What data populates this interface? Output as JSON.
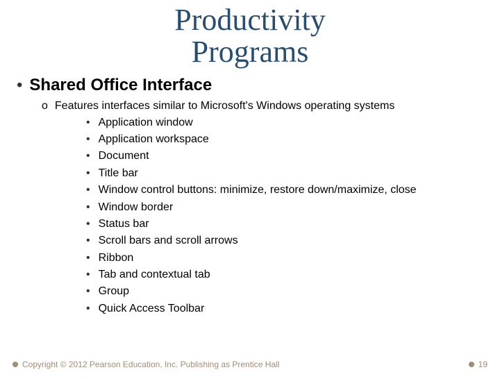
{
  "title_line1": "Productivity",
  "title_line2": "Programs",
  "heading": "Shared Office Interface",
  "subheading": "Features interfaces similar to Microsoft's Windows operating systems",
  "items": [
    "Application window",
    "Application workspace",
    "Document",
    "Title bar",
    "Window control buttons: minimize, restore down/maximize, close",
    "Window border",
    "Status bar",
    "Scroll bars and scroll arrows",
    "Ribbon",
    "Tab and contextual tab",
    "Group",
    "Quick Access Toolbar"
  ],
  "copyright": "Copyright © 2012 Pearson Education, Inc. Publishing as Prentice Hall",
  "page_number": "19"
}
